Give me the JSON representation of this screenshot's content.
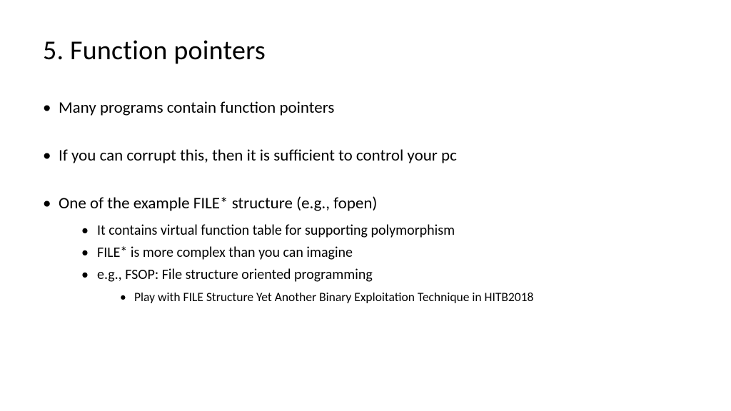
{
  "title": "5. Function pointers",
  "bullets": {
    "b1": "Many programs contain function pointers",
    "b2": "If you can corrupt this, then it is sufficient to control your pc",
    "b3": "One of the example FILE* structure (e.g., fopen)",
    "sub": {
      "s1": "It contains virtual function table for supporting polymorphism",
      "s2": "FILE* is more complex than you can imagine",
      "s3": "e.g., FSOP: File structure oriented programming",
      "detail": "Play with FILE Structure Yet Another Binary Exploitation Technique in HITB2018"
    }
  }
}
